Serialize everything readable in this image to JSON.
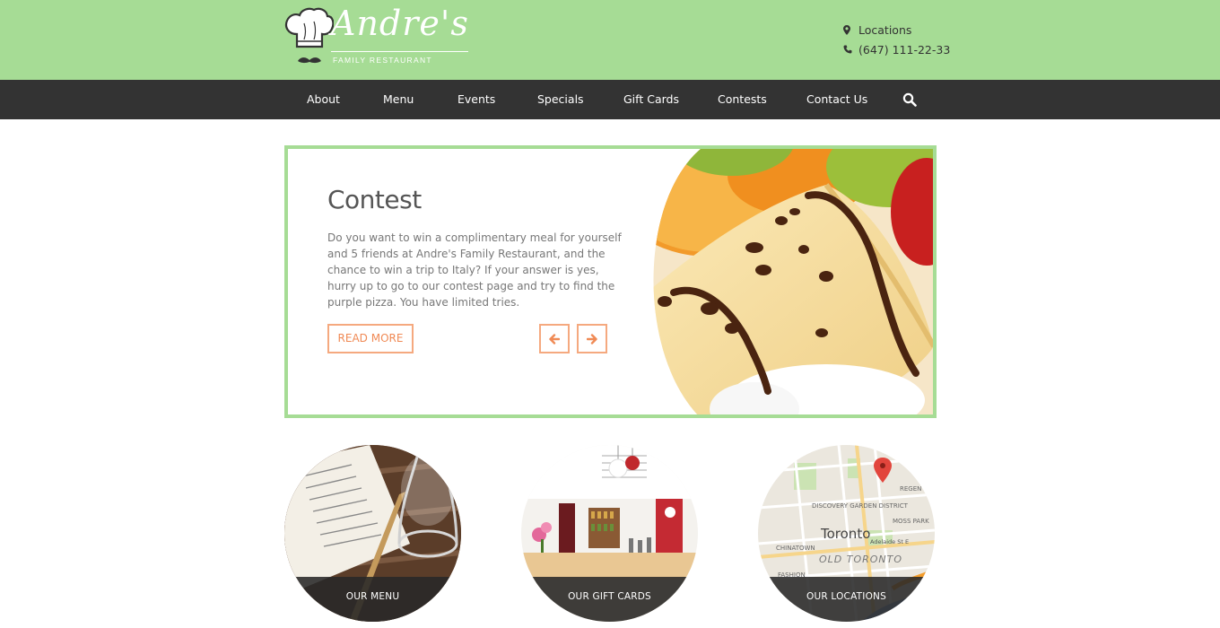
{
  "brand": {
    "script_name": "Andre's",
    "tagline": "FAMILY RESTAURANT"
  },
  "contact": {
    "locations_label": "Locations",
    "phone": "(647) 111-22-33",
    "location_icon": "map-marker-icon",
    "phone_icon": "phone-icon"
  },
  "nav": {
    "items": [
      "About",
      "Menu",
      "Events",
      "Specials",
      "Gift Cards",
      "Contests",
      "Contact Us"
    ],
    "search_icon": "search-icon"
  },
  "slide": {
    "title": "Contest",
    "text": "Do you want to win a complimentary meal for yourself and 5 friends at Andre's Family Restaurant, and the chance to win a trip to Italy? If your answer is yes, hurry up to go to our contest page and try to find the purple pizza. You have limited tries.",
    "read_more": "READ MORE"
  },
  "features": [
    {
      "label": "OUR MENU"
    },
    {
      "label": "OUR GIFT CARDS"
    },
    {
      "label": "OUR LOCATIONS"
    }
  ],
  "map_labels": {
    "city": "Toronto",
    "district": "OLD TORONTO",
    "discovery": "DISCOVERY GARDEN DISTRICT",
    "chinatown": "CHINATOWN",
    "moss_park": "MOSS PARK",
    "regent": "REGEN",
    "adelaide": "Adelaide St E",
    "fashion": "FASHION"
  },
  "colors": {
    "header_green": "#a6dc95",
    "nav_dark": "#333333",
    "accent_orange": "#f08a55"
  }
}
